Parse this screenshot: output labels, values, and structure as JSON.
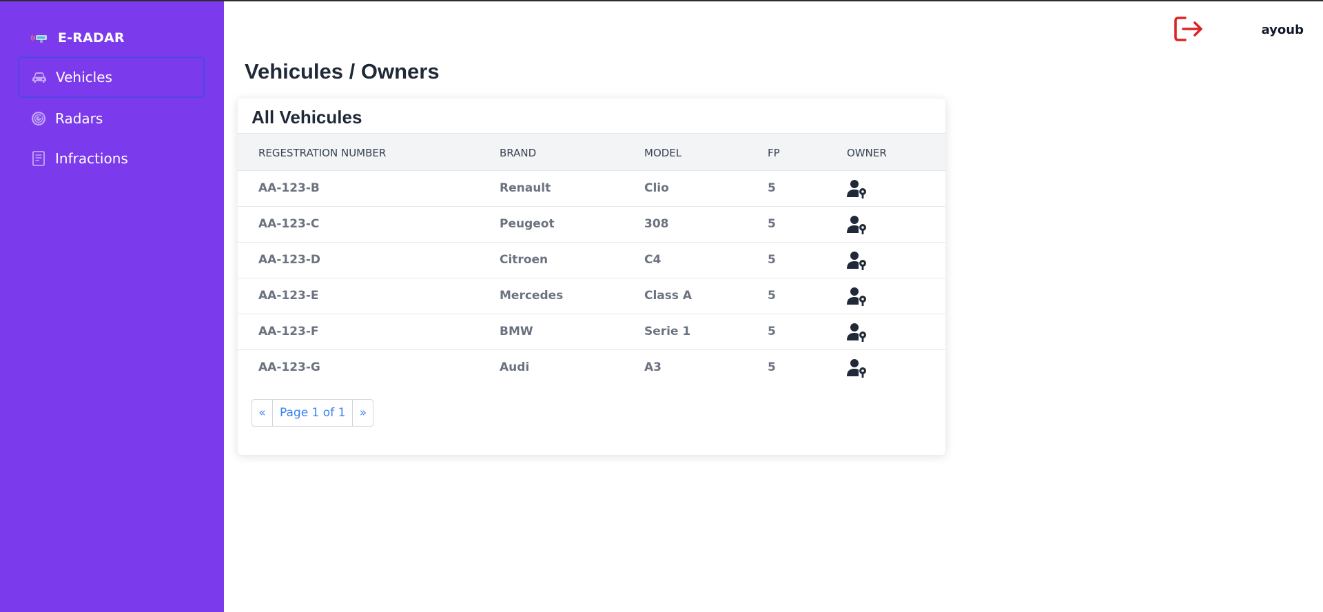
{
  "app": {
    "brand": "E-RADAR",
    "username": "ayoub"
  },
  "sidebar": {
    "items": [
      {
        "label": "Vehicles",
        "icon": "car-icon",
        "active": true
      },
      {
        "label": "Radars",
        "icon": "radar-icon",
        "active": false
      },
      {
        "label": "Infractions",
        "icon": "document-icon",
        "active": false
      }
    ]
  },
  "page": {
    "title": "Vehicules / Owners"
  },
  "card": {
    "title": "All Vehicules",
    "columns": [
      "REGESTRATION NUMBER",
      "BRAND",
      "MODEL",
      "FP",
      "OWNER"
    ],
    "rows": [
      {
        "reg": "AA-123-B",
        "brand": "Renault",
        "model": "Clio",
        "fp": "5"
      },
      {
        "reg": "AA-123-C",
        "brand": "Peugeot",
        "model": "308",
        "fp": "5"
      },
      {
        "reg": "AA-123-D",
        "brand": "Citroen",
        "model": "C4",
        "fp": "5"
      },
      {
        "reg": "AA-123-E",
        "brand": "Mercedes",
        "model": "Class A",
        "fp": "5"
      },
      {
        "reg": "AA-123-F",
        "brand": "BMW",
        "model": "Serie 1",
        "fp": "5"
      },
      {
        "reg": "AA-123-G",
        "brand": "Audi",
        "model": "A3",
        "fp": "5"
      }
    ],
    "pagination": {
      "prev": "«",
      "info": "Page 1 of 1",
      "next": "»"
    }
  },
  "colors": {
    "sidebar": "#7c3aed",
    "active_border": "#4f46e5",
    "logout": "#dc2626",
    "link": "#3b82f6"
  }
}
